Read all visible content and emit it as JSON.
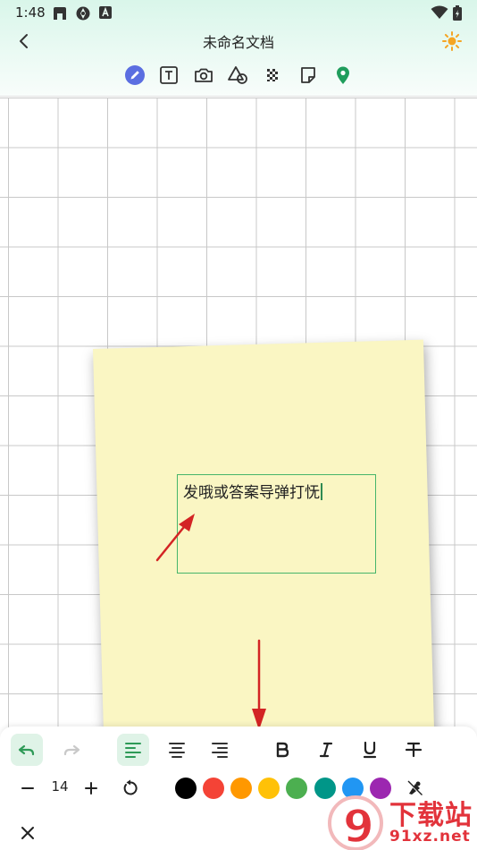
{
  "status_bar": {
    "time": "1:48",
    "icons": [
      "app-icon",
      "sync-icon",
      "a-letter-icon"
    ],
    "right_icons": [
      "wifi-icon",
      "battery-icon"
    ]
  },
  "title_bar": {
    "title": "未命名文档",
    "back_icon": "back-chevron-icon",
    "theme_icon": "sun-icon"
  },
  "tools": [
    {
      "name": "pen-tool",
      "icon": "pen-icon",
      "active": true
    },
    {
      "name": "text-tool",
      "icon": "text-box-icon"
    },
    {
      "name": "camera-tool",
      "icon": "camera-icon"
    },
    {
      "name": "shape-tool",
      "icon": "shapes-icon"
    },
    {
      "name": "mosaic-tool",
      "icon": "mosaic-icon"
    },
    {
      "name": "sticky-note-tool",
      "icon": "note-icon"
    },
    {
      "name": "location-tool",
      "icon": "location-pin-icon"
    }
  ],
  "canvas": {
    "note_color": "#faf6c3",
    "text": "发哦或答案导弹打怃"
  },
  "format_panel": {
    "font_size": "14",
    "buttons": [
      "undo",
      "redo",
      "align-left",
      "align-center",
      "align-right",
      "bold",
      "italic",
      "underline",
      "strikethrough"
    ],
    "colors": [
      "#000000",
      "#f44336",
      "#ff9800",
      "#ffc107",
      "#4caf50",
      "#009688",
      "#2196f3",
      "#9c27b0"
    ],
    "accent": "#2e9a57"
  },
  "watermark": {
    "logo_text": "9",
    "line1": "下载站",
    "line2": "91xz.net"
  }
}
